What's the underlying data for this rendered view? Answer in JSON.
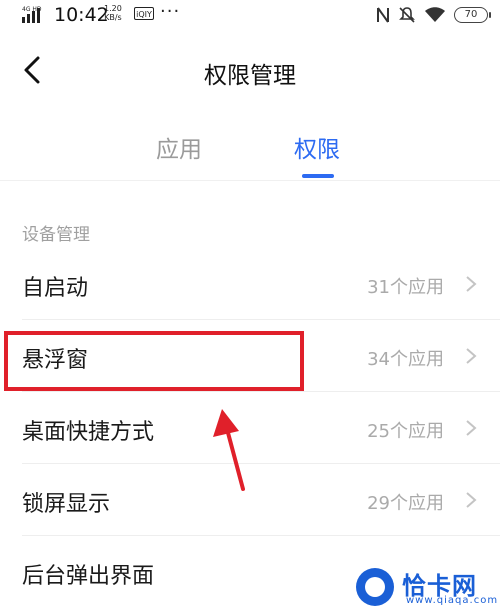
{
  "status_bar": {
    "network": "4G HD",
    "time": "10:42",
    "speed_value": "1.20",
    "speed_unit": "KB/s",
    "app_badge": "iQIY",
    "more": "···",
    "battery": "70",
    "icons": [
      "nfc-icon",
      "mute-icon",
      "wifi-icon",
      "battery-icon"
    ]
  },
  "nav": {
    "back_icon": "chevron-left-icon",
    "title": "权限管理"
  },
  "tabs": [
    {
      "label": "应用",
      "active": false
    },
    {
      "label": "权限",
      "active": true
    }
  ],
  "section": {
    "header": "设备管理"
  },
  "items": [
    {
      "label": "自启动",
      "count": "31个应用"
    },
    {
      "label": "悬浮窗",
      "count": "34个应用",
      "highlighted": true
    },
    {
      "label": "桌面快捷方式",
      "count": "25个应用"
    },
    {
      "label": "锁屏显示",
      "count": "29个应用"
    },
    {
      "label": "后台弹出界面",
      "count": ""
    }
  ],
  "colors": {
    "accent": "#2d6bf2",
    "highlight": "#e0202a",
    "muted": "#aaaaaa"
  },
  "watermark": {
    "text": "恰卡网",
    "sub": "www.qiaqa.com"
  }
}
